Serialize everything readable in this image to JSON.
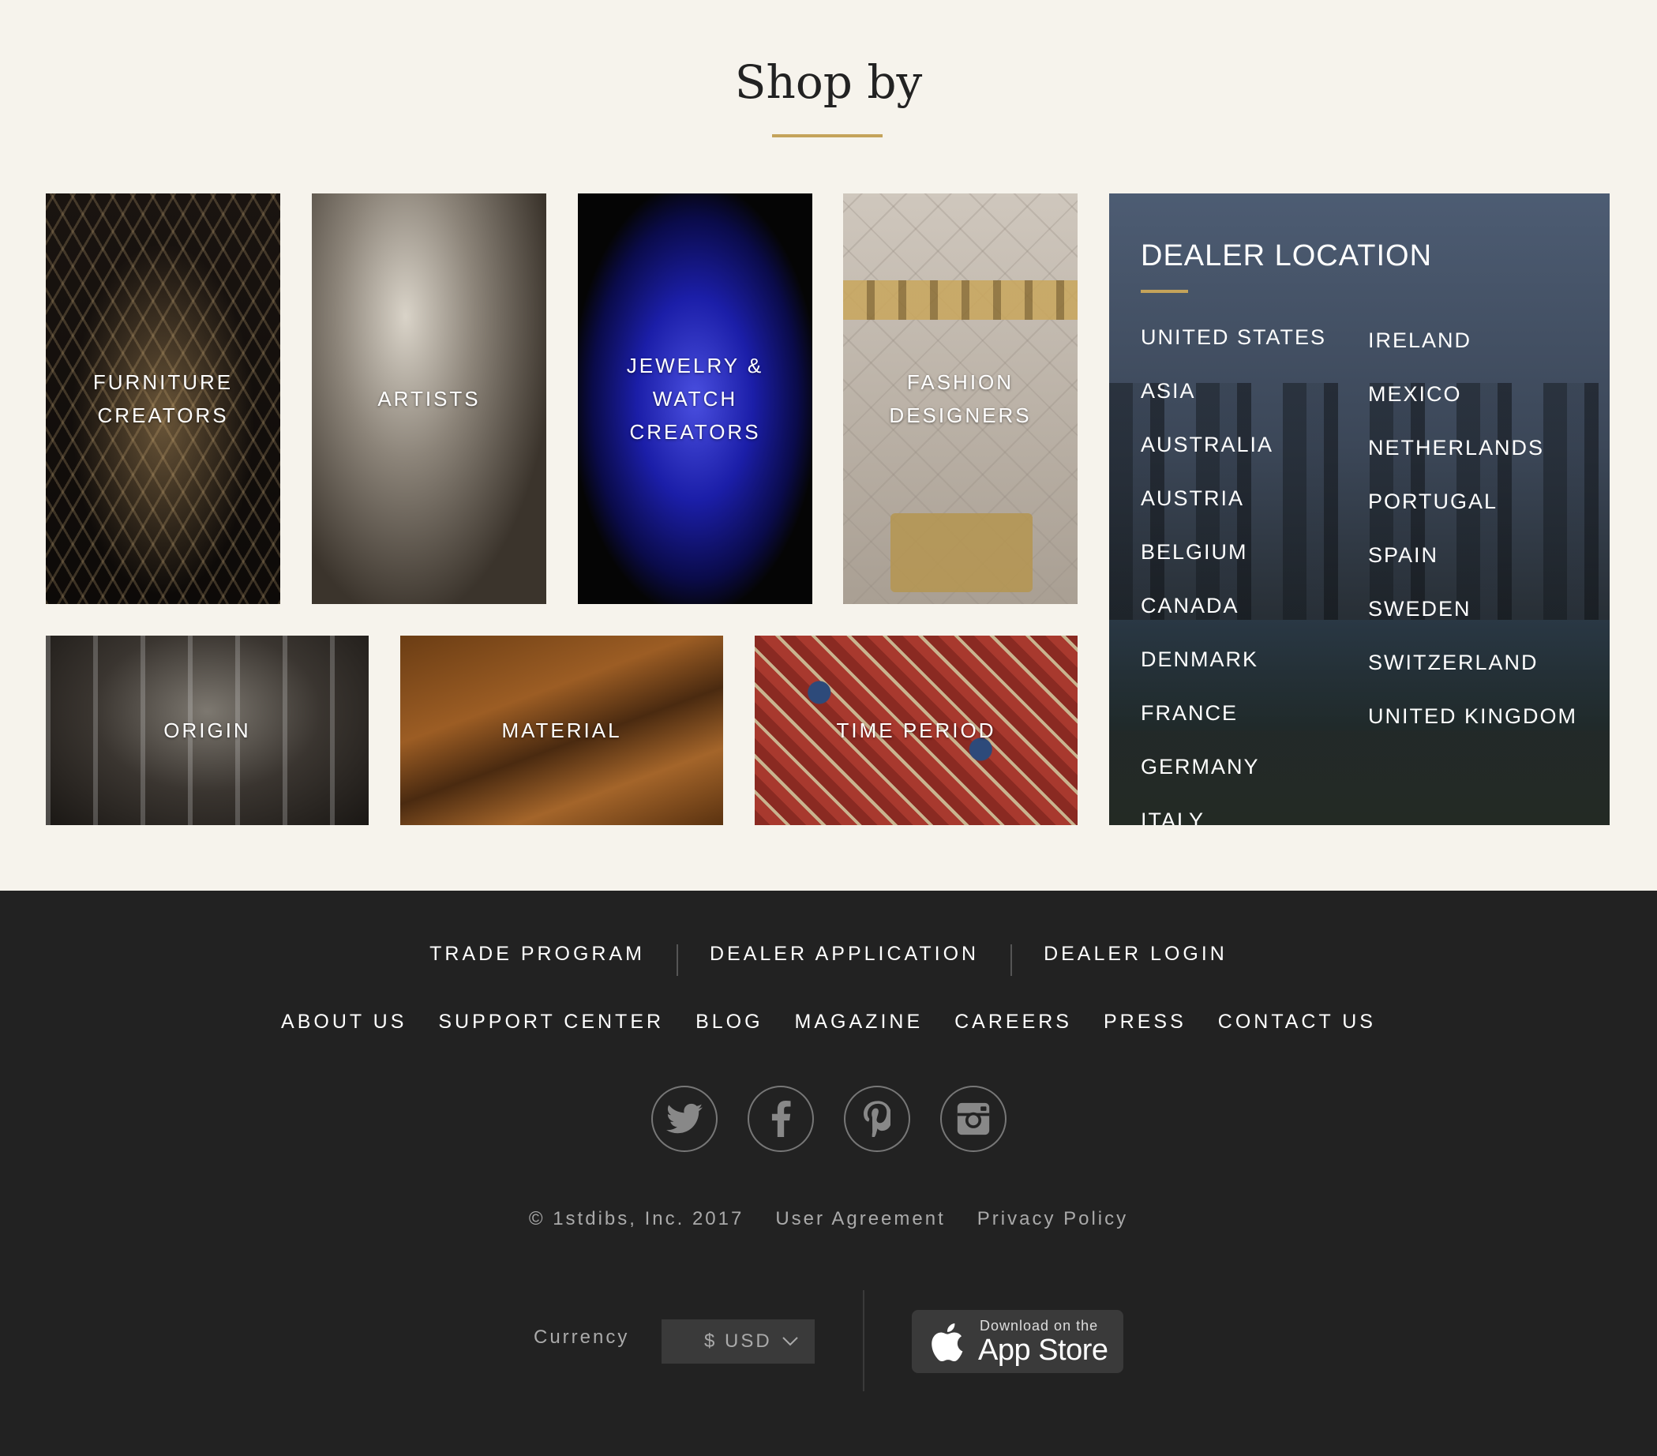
{
  "heading": "Shop by",
  "tiles": {
    "furniture": "FURNITURE CREATORS",
    "artists": "ARTISTS",
    "jewelry": "JEWELRY & WATCH CREATORS",
    "fashion": "FASHION DESIGNERS",
    "origin": "ORIGIN",
    "material": "MATERIAL",
    "time_period": "TIME PERIOD"
  },
  "dealer_location": {
    "title": "DEALER LOCATION",
    "col1": [
      "UNITED STATES",
      "ASIA",
      "AUSTRALIA",
      "AUSTRIA",
      "BELGIUM",
      "CANADA",
      "DENMARK",
      "FRANCE",
      "GERMANY",
      "ITALY"
    ],
    "col2": [
      "IRELAND",
      "MEXICO",
      "NETHERLANDS",
      "PORTUGAL",
      "SPAIN",
      "SWEDEN",
      "SWITZERLAND",
      "UNITED KINGDOM"
    ]
  },
  "footer": {
    "primary_links": [
      "TRADE PROGRAM",
      "DEALER APPLICATION",
      "DEALER LOGIN"
    ],
    "secondary_links": [
      "ABOUT US",
      "SUPPORT CENTER",
      "BLOG",
      "MAGAZINE",
      "CAREERS",
      "PRESS",
      "CONTACT US"
    ],
    "social_icons": [
      "twitter-icon",
      "facebook-icon",
      "pinterest-icon",
      "instagram-icon"
    ],
    "copyright": "© 1stdibs, Inc. 2017",
    "user_agreement": "User Agreement",
    "privacy_policy": "Privacy Policy",
    "currency_label": "Currency",
    "currency_value": "$ USD",
    "appstore_small": "Download on the",
    "appstore_big": "App Store"
  },
  "colors": {
    "accent": "#c4a35a",
    "page_bg": "#f6f3ec",
    "footer_bg": "#222222"
  }
}
